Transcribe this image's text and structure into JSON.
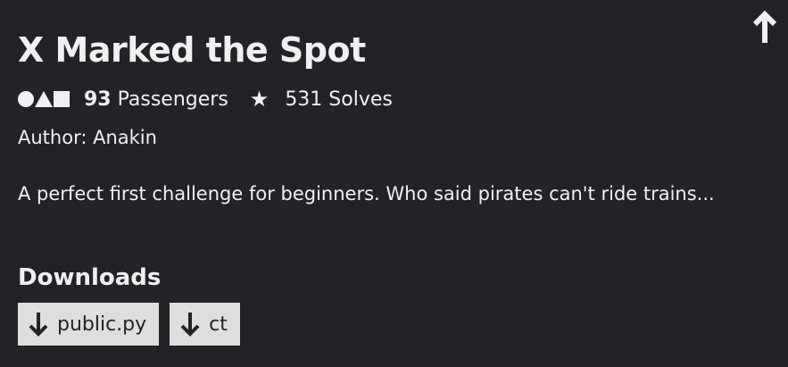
{
  "challenge": {
    "title": "X Marked the Spot",
    "passengers_count": "93",
    "passengers_label": "Passengers",
    "solves": "531 Solves",
    "author": "Author: Anakin",
    "description": "A perfect first challenge for beginners. Who said pirates can't ride trains..."
  },
  "downloads": {
    "heading": "Downloads",
    "files": [
      {
        "label": "public.py",
        "icon": "download-arrow-icon"
      },
      {
        "label": "ct",
        "icon": "download-arrow-icon"
      }
    ]
  },
  "icons": {
    "scroll_top": "arrow-up-icon",
    "shapes": "circle-triangle-square-icon",
    "star": "star-icon"
  },
  "colors": {
    "background": "#242227",
    "text": "#f0f0f2",
    "button": "#dedede"
  }
}
